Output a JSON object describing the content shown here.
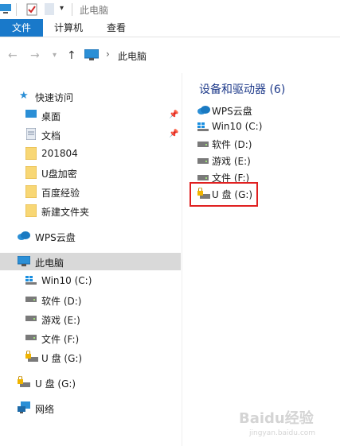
{
  "window": {
    "title": "此电脑"
  },
  "ribbon": {
    "tabs": [
      {
        "label": "文件"
      },
      {
        "label": "计算机"
      },
      {
        "label": "查看"
      }
    ]
  },
  "address": {
    "breadcrumb": "此电脑",
    "separator": "›"
  },
  "nav": {
    "quick_access": "快速访问",
    "quick_items": [
      {
        "label": "桌面"
      },
      {
        "label": "文档"
      },
      {
        "label": "201804"
      },
      {
        "label": "U盘加密"
      },
      {
        "label": "百度经验"
      },
      {
        "label": "新建文件夹"
      }
    ],
    "wps": "WPS云盘",
    "this_pc": "此电脑",
    "pc_items": [
      {
        "label": "Win10 (C:)"
      },
      {
        "label": "软件 (D:)"
      },
      {
        "label": "游戏 (E:)"
      },
      {
        "label": "文件 (F:)"
      },
      {
        "label": "U 盘 (G:)"
      }
    ],
    "usb": "U 盘 (G:)",
    "network": "网络"
  },
  "content": {
    "section_title": "设备和驱动器 (6)",
    "drives": [
      {
        "label": "WPS云盘"
      },
      {
        "label": "Win10 (C:)"
      },
      {
        "label": "软件 (D:)"
      },
      {
        "label": "游戏 (E:)"
      },
      {
        "label": "文件 (F:)"
      },
      {
        "label": "U 盘 (G:)"
      }
    ]
  },
  "watermark": {
    "main": "Baidu经验",
    "sub": "jingyan.baidu.com"
  },
  "colors": {
    "file_tab": "#1979ca",
    "highlight": "#e02020",
    "section_title": "#1e3a8a"
  }
}
